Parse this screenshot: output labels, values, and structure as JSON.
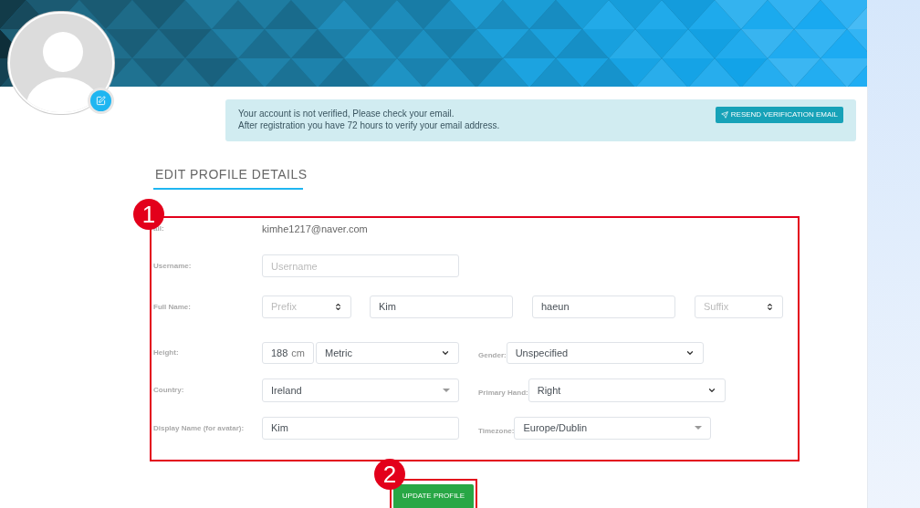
{
  "alert": {
    "lines": [
      "Your account is not verified, Please check your email.",
      "After registration you have 72 hours to verify your email address."
    ],
    "button": "RESEND VERIFICATION EMAIL"
  },
  "section_title": "EDIT PROFILE DETAILS",
  "form": {
    "email": {
      "label": "ail:",
      "value": "kimhe1217@naver.com"
    },
    "username": {
      "label": "Username:",
      "placeholder": "Username"
    },
    "full_name": {
      "label": "Full Name:",
      "prefix": {
        "placeholder": "Prefix"
      },
      "first": "Kim",
      "last": "haeun",
      "suffix": {
        "placeholder": "Suffix"
      }
    },
    "height": {
      "label": "Height:",
      "value": "188",
      "unit": "cm",
      "system": "Metric"
    },
    "gender": {
      "label": "Gender:",
      "value": "Unspecified",
      "kind": "native"
    },
    "country": {
      "label": "Country:",
      "value": "Ireland",
      "kind": "search"
    },
    "primary_hand": {
      "label": "Primary Hand:",
      "value": "Right",
      "kind": "native"
    },
    "display_name": {
      "label": "Display Name (for avatar):",
      "value": "Kim"
    },
    "timezone": {
      "label": "Timezone:",
      "value": "Europe/Dublin",
      "kind": "search"
    }
  },
  "submit": "UPDATE PROFILE",
  "annotations": [
    {
      "label": "1"
    },
    {
      "label": "2"
    }
  ]
}
